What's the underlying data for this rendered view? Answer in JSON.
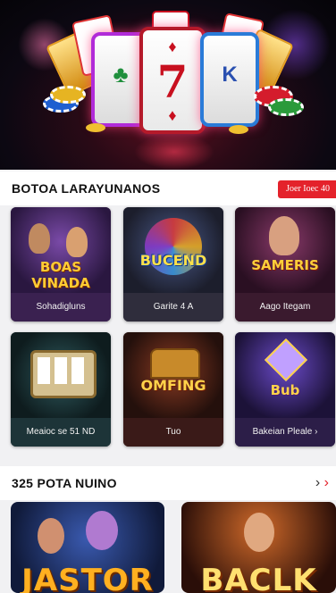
{
  "hero": {
    "reel_symbols": [
      "7",
      "K"
    ]
  },
  "section1": {
    "title": "BOTOA LARAYUNANOS",
    "see_all": "Joer Ioec 40",
    "tiles": [
      {
        "logo": "BOAS VINADA",
        "caption": "Sohadigluns"
      },
      {
        "logo": "BUCEND",
        "caption": "Garite 4 A"
      },
      {
        "logo": "SAMERIS",
        "caption": "Aago Itegam"
      },
      {
        "logo": "",
        "caption": "Meaioc se 51 ND"
      },
      {
        "logo": "OMFING",
        "caption": "Tuo"
      },
      {
        "logo": "Bub",
        "caption": "Bakeian Pleale ›"
      }
    ]
  },
  "section2": {
    "title": "325 POTA NUINO",
    "tiles": [
      {
        "logo": "JASTOR"
      },
      {
        "logo": "BACLK"
      }
    ]
  }
}
